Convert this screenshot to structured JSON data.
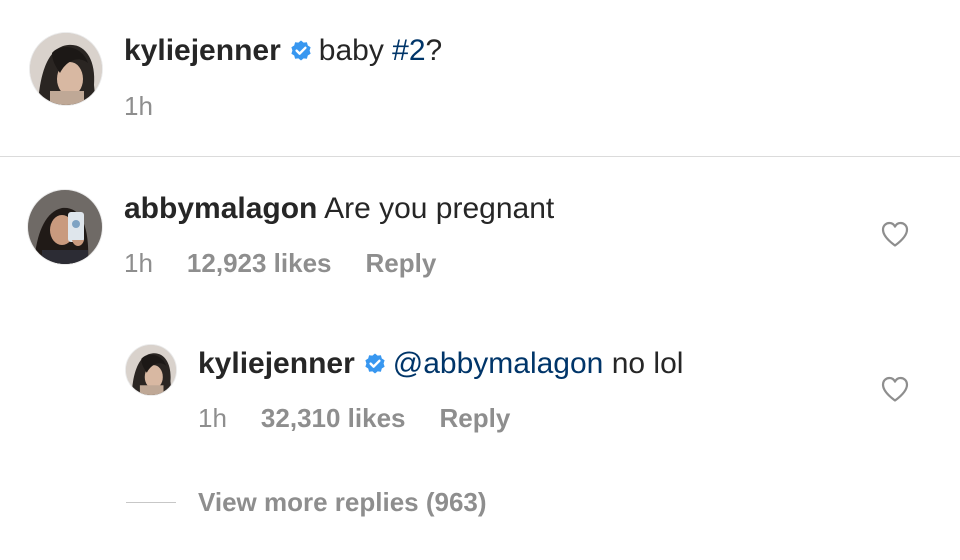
{
  "caption": {
    "username": "kyliejenner",
    "verified": true,
    "text_before": "baby ",
    "hashtag": "#2",
    "text_after": "?",
    "time": "1h"
  },
  "comment": {
    "username": "abbymalagon",
    "text": "Are you pregnant",
    "time": "1h",
    "likes": "12,923 likes",
    "reply_label": "Reply",
    "like_icon": "heart-outline-icon"
  },
  "reply": {
    "username": "kyliejenner",
    "verified": true,
    "mention": "@abbymalagon",
    "text": " no lol",
    "time": "1h",
    "likes": "32,310 likes",
    "reply_label": "Reply",
    "like_icon": "heart-outline-icon"
  },
  "view_more": {
    "label": "View more replies (963)"
  },
  "colors": {
    "text": "#262626",
    "secondary": "#8e8e8e",
    "link": "#003569",
    "verified_badge": "#3897f0",
    "divider": "#dbdbdb"
  }
}
